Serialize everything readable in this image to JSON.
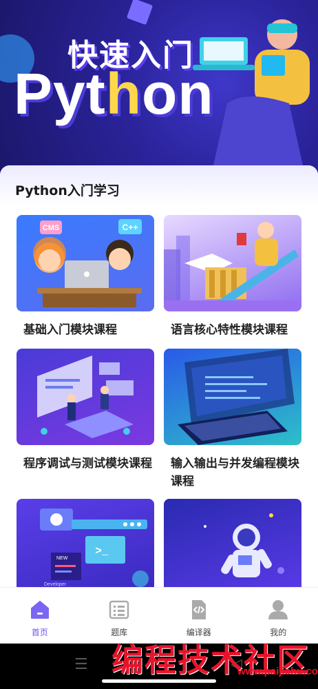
{
  "hero": {
    "title": "快速入门",
    "big_prefix": "Pyt",
    "big_accent": "h",
    "big_suffix": "on"
  },
  "section": {
    "title": "Python入门学习"
  },
  "courses": [
    {
      "label": "基础入门模块课程"
    },
    {
      "label": "语言核心特性模块课程"
    },
    {
      "label": "程序调试与测试模块课程"
    },
    {
      "label": "输入输出与并发编程模块课程"
    },
    {
      "label": ""
    },
    {
      "label": ""
    }
  ],
  "thumb_text": {
    "cms": "CMS",
    "cpp": "C++",
    "new": "NEW",
    "developer": "Developer",
    "prompt": ">_"
  },
  "tabs": [
    {
      "label": "首页",
      "icon": "home-icon",
      "active": true
    },
    {
      "label": "题库",
      "icon": "list-icon",
      "active": false
    },
    {
      "label": "编译器",
      "icon": "code-file-icon",
      "active": false
    },
    {
      "label": "我的",
      "icon": "user-icon",
      "active": false
    }
  ],
  "watermark": {
    "text": "编程技术社区",
    "url": "www.paijishu.com"
  },
  "colors": {
    "accent": "#6a55f0",
    "hero": "#2a239a",
    "watermark": "#e8132a"
  }
}
